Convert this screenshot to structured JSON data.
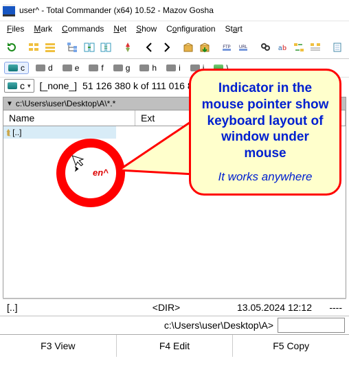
{
  "window": {
    "title": "user^ - Total Commander (x64) 10.52 - Mazov Gosha"
  },
  "menu": {
    "files": "Files",
    "mark": "Mark",
    "commands": "Commands",
    "net": "Net",
    "show": "Show",
    "configuration": "Configuration",
    "start": "Start"
  },
  "drives": {
    "items": [
      {
        "letter": "c",
        "type": "ssd",
        "active": true
      },
      {
        "letter": "d",
        "type": "hdd"
      },
      {
        "letter": "e",
        "type": "hdd"
      },
      {
        "letter": "f",
        "type": "hdd"
      },
      {
        "letter": "g",
        "type": "hdd"
      },
      {
        "letter": "h",
        "type": "hdd"
      },
      {
        "letter": "i",
        "type": "hdd"
      },
      {
        "letter": "j",
        "type": "hdd"
      },
      {
        "letter": "\\",
        "type": "net"
      }
    ],
    "combo_letter": "c",
    "volume_label": "[_none_]",
    "free_text": "51 126 380 k of 111 016 820 k free"
  },
  "path": {
    "text": "c:\\Users\\user\\Desktop\\A\\*.*"
  },
  "columns": {
    "name": "Name",
    "ext": "Ext"
  },
  "filelist": {
    "up": "[..]"
  },
  "cursor_indicator": {
    "label": "en^"
  },
  "annotation": {
    "headline": "Indicator in the mouse pointer show keyboard layout of window under mouse",
    "sub": "It works anywhere"
  },
  "status": {
    "name": "[..]",
    "type": "<DIR>",
    "date": "13.05.2024 12:12",
    "attrs": "----"
  },
  "cmdline": {
    "prompt": "c:\\Users\\user\\Desktop\\A>"
  },
  "fkeys": {
    "f3": "F3 View",
    "f4": "F4 Edit",
    "f5": "F5 Copy"
  }
}
